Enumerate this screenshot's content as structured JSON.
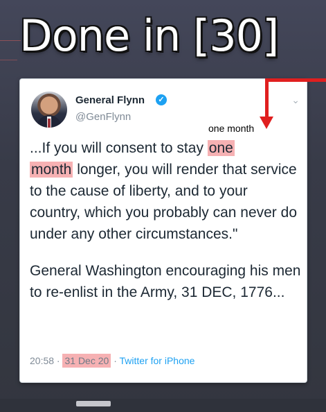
{
  "headline": "Done in [30]",
  "annotation": {
    "label": "one month",
    "arrow_color": "#e01f1f"
  },
  "tweet": {
    "author_name": "General Flynn",
    "handle": "@GenFlynn",
    "verified": true,
    "avatar_icon": "avatar-photo",
    "text_before": "...If you will consent to stay ",
    "highlight_1": "one",
    "highlight_2": "month",
    "text_after": " longer, you will render that service to the cause of liberty, and to your country, which you probably can never do under any other circumstances.\"",
    "paragraph_2": "General Washington encouraging his men to re-enlist in the Army, 31 DEC, 1776...",
    "time": "20:58 · ",
    "date": "31 Dec 20",
    "separator": " · ",
    "source": "Twitter for iPhone"
  },
  "colors": {
    "highlight": "#f6b1b3",
    "link": "#1da1f2",
    "background": "#3a3d4a"
  }
}
